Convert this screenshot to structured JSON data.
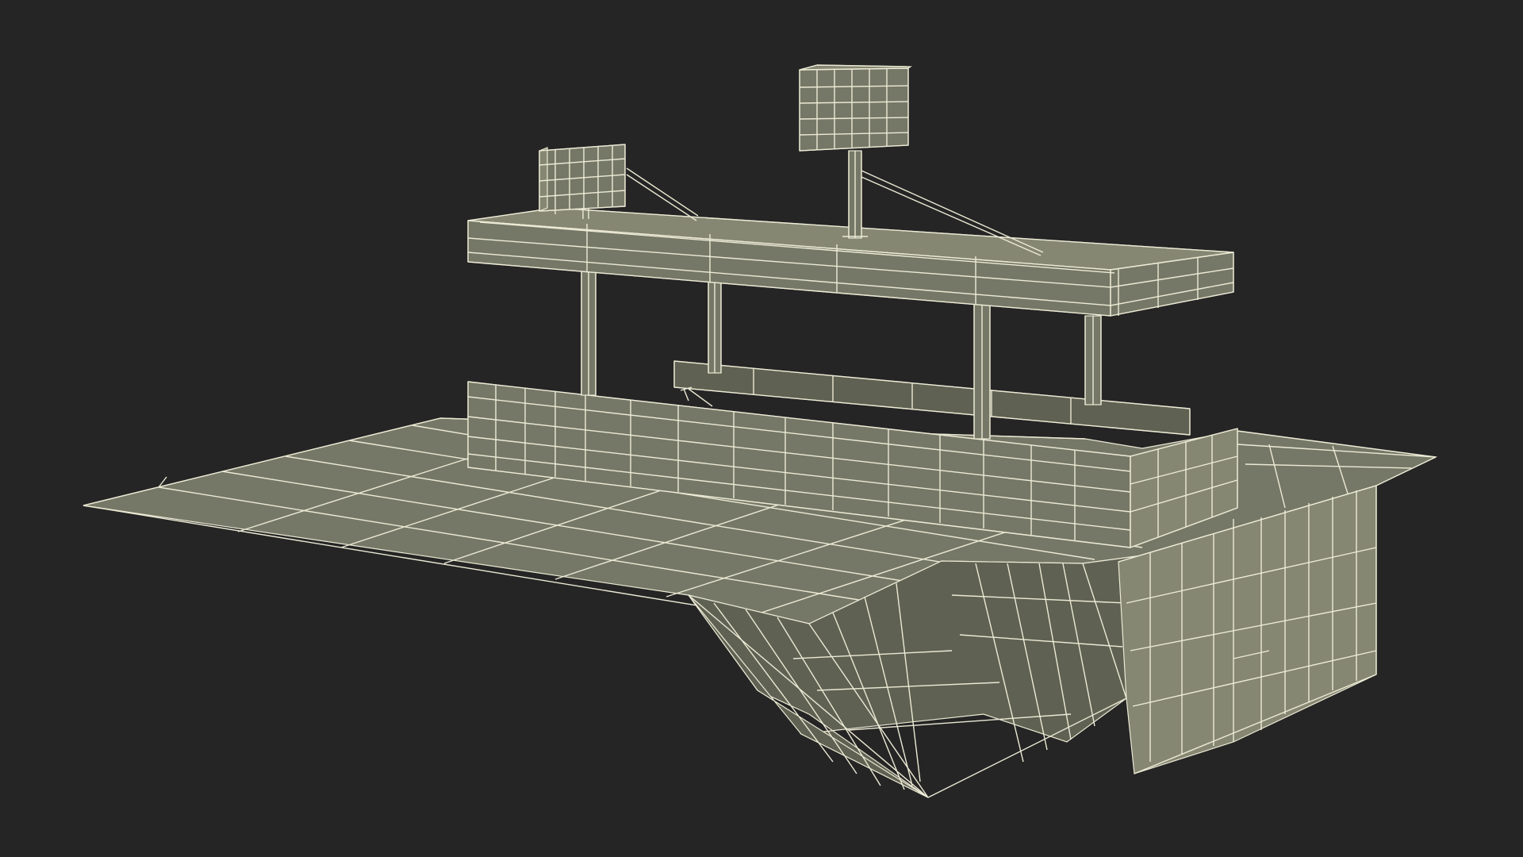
{
  "scene": {
    "subject": "wireframe-3d-model",
    "colors": {
      "background": "#252525",
      "surface": "#767867",
      "surface_dark": "#5f6152",
      "surface_light": "#858773",
      "wire": "#ecead5"
    }
  }
}
